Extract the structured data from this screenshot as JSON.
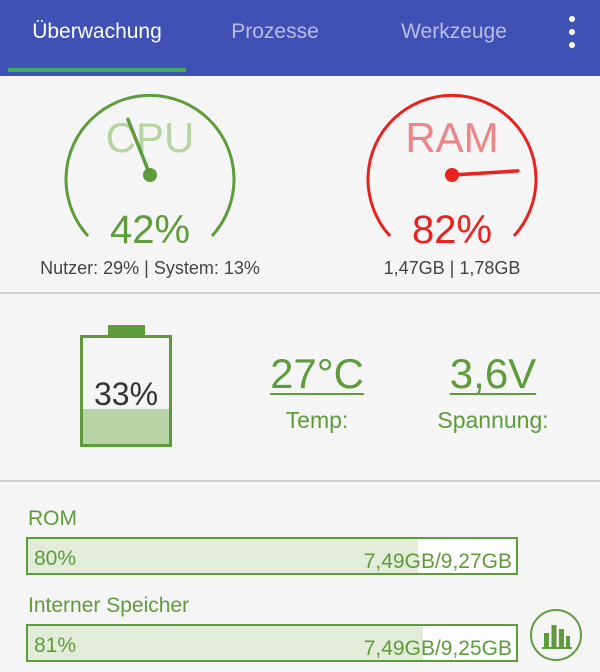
{
  "tabs": [
    {
      "label": "Überwachung",
      "active": true
    },
    {
      "label": "Prozesse",
      "active": false
    },
    {
      "label": "Werkzeuge",
      "active": false
    }
  ],
  "overflow_icon": "more-vert-icon",
  "cpu": {
    "label": "CPU",
    "value": "42%",
    "detail": "Nutzer: 29% | System: 13%",
    "color": "#5e9c3b",
    "fraction": 0.42
  },
  "ram": {
    "label": "RAM",
    "value": "82%",
    "detail": "1,47GB | 1,78GB",
    "color": "#e8221e",
    "fraction": 0.82
  },
  "battery": {
    "value": "33%",
    "fraction": 0.33,
    "color": "#5e9c3b"
  },
  "temperature": {
    "value": "27°C",
    "label": "Temp:"
  },
  "voltage": {
    "value": "3,6V",
    "label": "Spannung:"
  },
  "storage": [
    {
      "title": "ROM",
      "percent": "80%",
      "size": "7,49GB/9,27GB",
      "fraction": 0.8
    },
    {
      "title": "Interner Speicher",
      "percent": "81%",
      "size": "7,49GB/9,25GB",
      "fraction": 0.81
    }
  ],
  "fab_icon": "bar-chart-icon"
}
